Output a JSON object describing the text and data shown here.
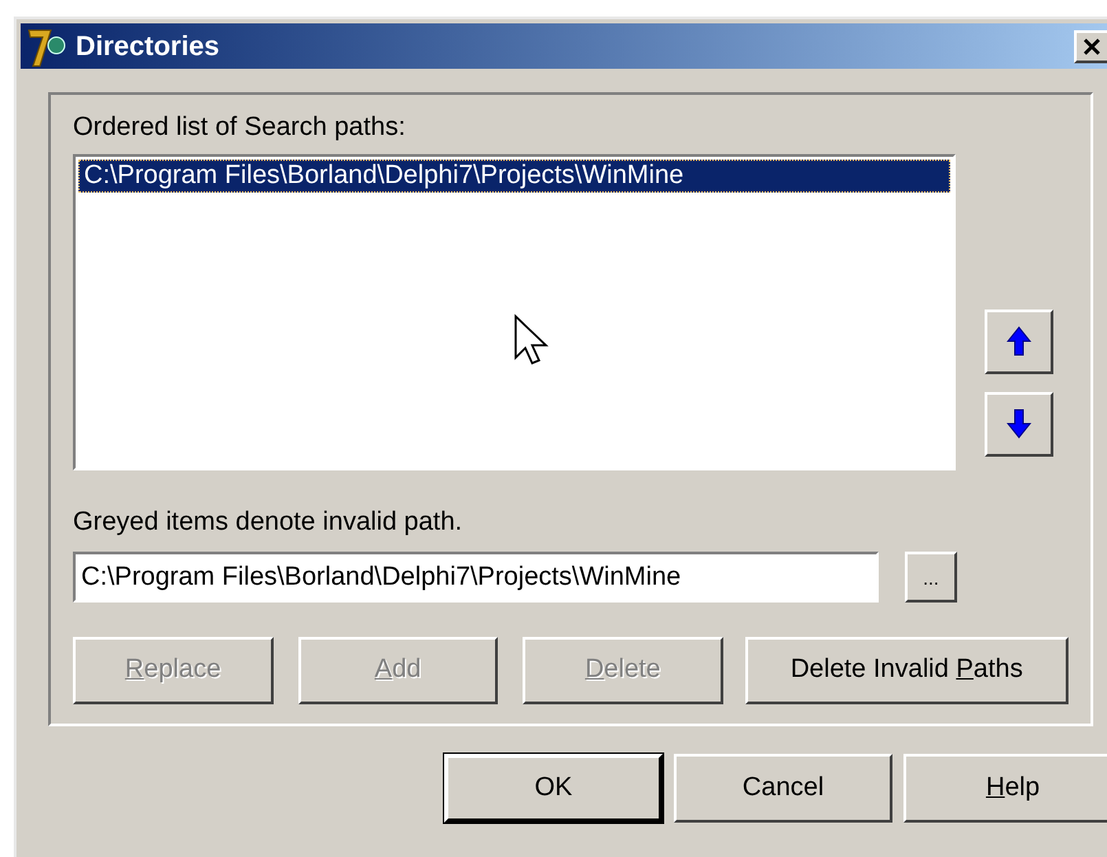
{
  "window": {
    "title": "Directories"
  },
  "list": {
    "label": "Ordered list of Search paths:",
    "items": [
      {
        "text": "C:\\Program Files\\Borland\\Delphi7\\Projects\\WinMine",
        "selected": true
      }
    ]
  },
  "note": "Greyed items denote invalid path.",
  "path_field": {
    "value": "C:\\Program Files\\Borland\\Delphi7\\Projects\\WinMine"
  },
  "browse_button": "...",
  "action_buttons": [
    {
      "key": "R",
      "post": "eplace",
      "disabled": true
    },
    {
      "key": "A",
      "post": "dd",
      "disabled": true
    },
    {
      "key": "D",
      "post": "elete",
      "disabled": true
    },
    {
      "pre": "Delete Invalid ",
      "key": "P",
      "post": "aths",
      "disabled": false
    }
  ],
  "dialog_buttons": [
    {
      "pre": "OK",
      "default": true
    },
    {
      "pre": "Cancel",
      "default": false
    },
    {
      "key": "H",
      "post": "elp",
      "default": false
    }
  ]
}
